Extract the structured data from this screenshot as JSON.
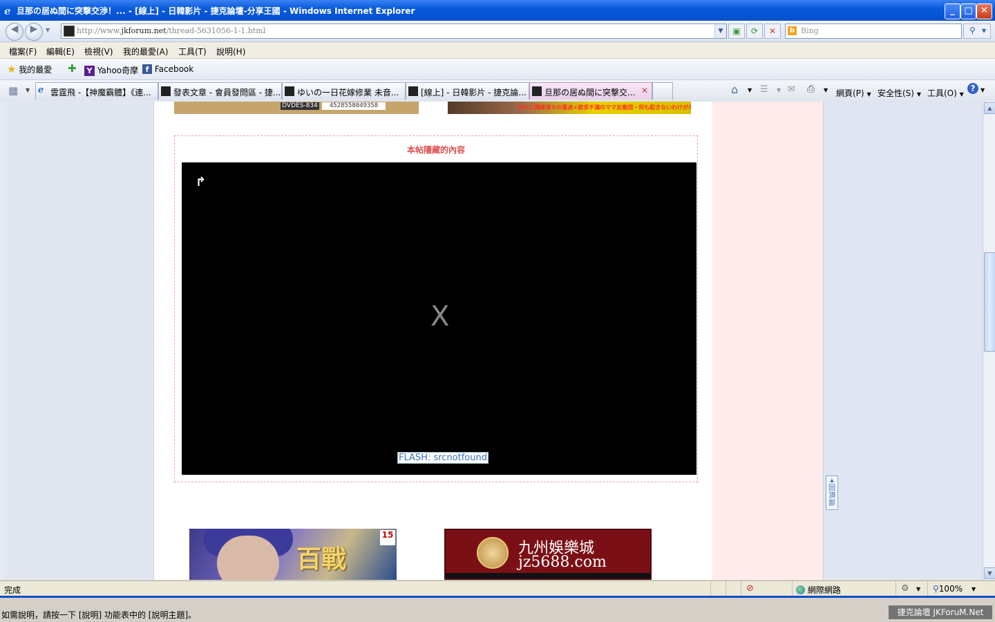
{
  "window": {
    "title": "旦那の居ぬ間に突撃交渉！... - [線上] - 日韓影片 - 捷克論壇-分享王國 - Windows Internet Explorer",
    "min": "_",
    "max": "□",
    "close": "✕"
  },
  "address": {
    "url_prefix": "http://www.",
    "url_domain": "jkforum.net",
    "url_path": "/thread-5631056-1-1.html"
  },
  "search": {
    "placeholder": "Bing"
  },
  "menu": [
    "檔案(F)",
    "編輯(E)",
    "檢視(V)",
    "我的最愛(A)",
    "工具(T)",
    "說明(H)"
  ],
  "favorites": {
    "label": "我的最愛",
    "items": [
      "Yahoo奇摩",
      "Facebook"
    ]
  },
  "tabs": [
    {
      "label": "雲霆飛 -【神魔霸體】《連...",
      "icon": "ie-icon"
    },
    {
      "label": "發表文章 - 會員發問區 - 捷...",
      "icon": "site-icon"
    },
    {
      "label": "ゆいの一日花嫁修業 未音...",
      "icon": "site-icon"
    },
    {
      "label": "[線上] - 日韓影片 - 捷克論...",
      "icon": "site-icon"
    },
    {
      "label": "旦那の居ぬ間に突撃交...",
      "icon": "site-icon",
      "active": true
    }
  ],
  "toolbar": {
    "page": "網頁(P)",
    "safety": "安全性(S)",
    "tools": "工具(O)"
  },
  "content": {
    "banner1_text": "DVDES-834",
    "banner1_code": "4528558049358",
    "banner2_text": "SEXに興味津々の童貞×欲求不満のママ友集団・何も起きないわけがない!!",
    "hidden_title": "本帖隱藏的內容",
    "player_x": "X",
    "player_error": "FLASH: srcnotfound",
    "ad2_name": "九州娛樂城",
    "ad2_site": "jz5688.com",
    "ad1_rating": "15",
    "ad1_title": "百戰",
    "totop": "回頂部"
  },
  "status": {
    "text": "完成",
    "zone": "網際網路",
    "zoom": "100%"
  },
  "help_text": "如需說明，請按一下 [說明] 功能表中的 [說明主題]。",
  "watermark": "捷克論壇 JKForuM.Net"
}
